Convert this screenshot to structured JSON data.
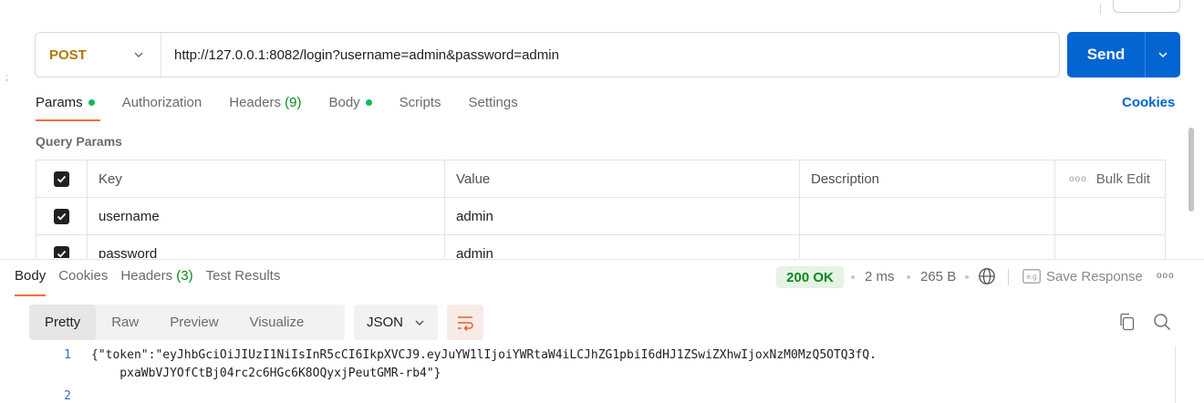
{
  "request": {
    "method": "POST",
    "url": "http://127.0.0.1:8082/login?username=admin&password=admin",
    "send_label": "Send"
  },
  "request_tabs": [
    {
      "label": "Params",
      "active": true,
      "dot": true
    },
    {
      "label": "Authorization"
    },
    {
      "label": "Headers",
      "count": "(9)"
    },
    {
      "label": "Body",
      "dot": true
    },
    {
      "label": "Scripts"
    },
    {
      "label": "Settings"
    }
  ],
  "cookies_link": "Cookies",
  "query_params": {
    "title": "Query Params",
    "headers": {
      "key": "Key",
      "value": "Value",
      "description": "Description",
      "bulk_edit": "Bulk Edit",
      "more": "ooo"
    },
    "rows": [
      {
        "key": "username",
        "value": "admin",
        "description": "",
        "checked": true
      },
      {
        "key": "password",
        "value": "admin",
        "description": "",
        "checked": true
      }
    ]
  },
  "response_tabs": [
    {
      "label": "Body",
      "active": true
    },
    {
      "label": "Cookies"
    },
    {
      "label": "Headers",
      "count": "(3)"
    },
    {
      "label": "Test Results"
    }
  ],
  "response_meta": {
    "status": "200 OK",
    "time": "2 ms",
    "size": "265 B",
    "save_response": "Save Response",
    "more": "ooo",
    "save_icon_label": "e.g"
  },
  "view_modes": [
    "Pretty",
    "Raw",
    "Preview",
    "Visualize"
  ],
  "active_view": "Pretty",
  "format": "JSON",
  "response_body": {
    "line_numbers": [
      "1",
      "2"
    ],
    "line1_a": "{\"token\":\"eyJhbGciOiJIUzI1NiIsInR5cCI6IkpXVCJ9.eyJuYW1lIjoiYWRtaW4iLCJhZG1pbiI6dHJ1ZSwiZXhwIjoxNzM0MzQ5OTQ3fQ.",
    "line1_b": "    pxaWbVJYOfCtBj04rc2c6HGc6K8OQyxjPeutGMR-rb4\"}"
  },
  "colors": {
    "send": "#0265d2",
    "method": "#ad7a03",
    "status_ok": "#0b8a1f",
    "active_underline": "#ff6c37",
    "dot": "#0cbb52"
  },
  "icons": [
    "chevron-down-icon",
    "globe-icon",
    "save-icon",
    "wrap-icon",
    "copy-icon",
    "search-icon"
  ]
}
